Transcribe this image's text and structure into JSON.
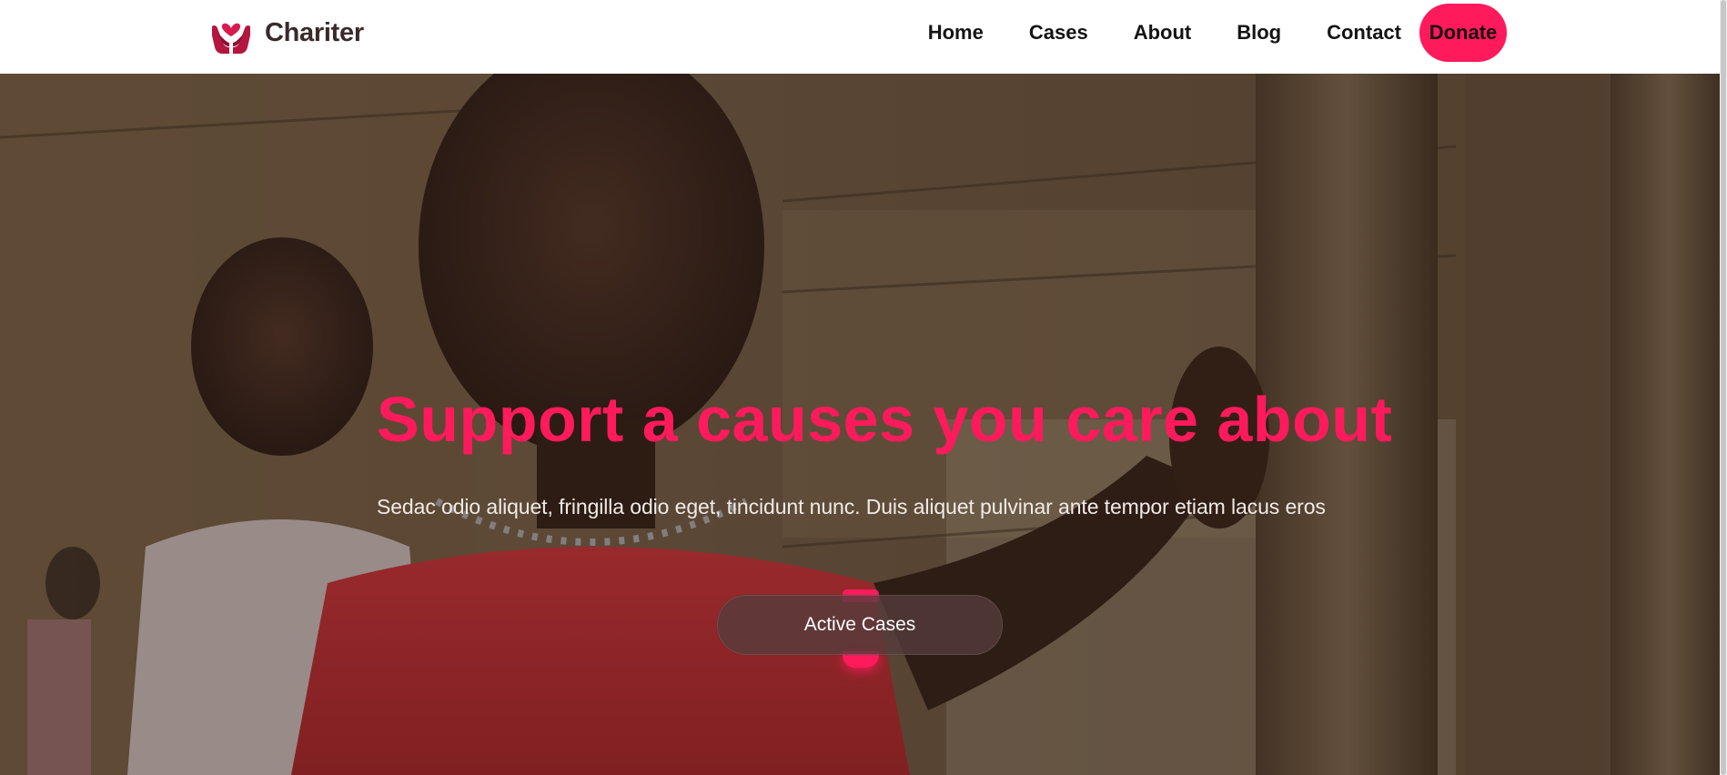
{
  "brand": {
    "name": "Chariter",
    "icon": "heart-hands-icon",
    "color": "#d81b4f"
  },
  "nav": {
    "items": [
      {
        "label": "Home"
      },
      {
        "label": "Cases"
      },
      {
        "label": "About"
      },
      {
        "label": "Blog"
      },
      {
        "label": "Contact"
      }
    ],
    "donate_label": "Donate",
    "accent": "#ff1a5c"
  },
  "hero": {
    "title": "Support a causes you care about",
    "subtitle": "Sedac odio aliquet, fringilla odio eget, tincidunt nunc. Duis aliquet pulvinar ante tempor etiam lacus eros",
    "cta_label": "Active Cases",
    "title_color": "#ff1a5c"
  }
}
